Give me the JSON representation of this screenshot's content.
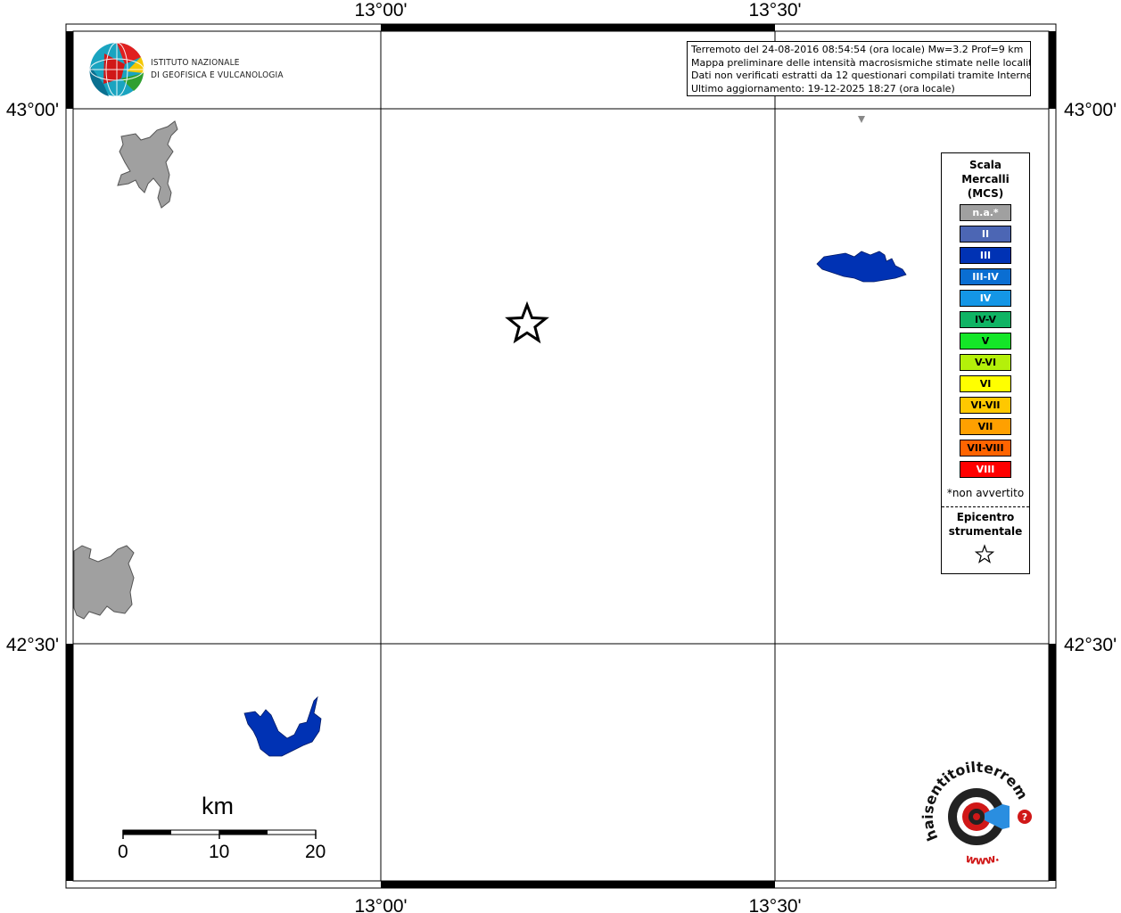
{
  "map": {
    "lon_labels": [
      "13°00'",
      "13°30'"
    ],
    "lat_labels": [
      "43°00'",
      "42°30'"
    ]
  },
  "info": {
    "line1": "Terremoto del 24-08-2016 08:54:54 (ora locale) Mw=3.2 Prof=9 km",
    "line2": "Mappa preliminare delle intensità macrosismiche stimate nelle località",
    "line3": "Dati non verificati estratti da 12 questionari compilati tramite Internet.",
    "line4": "Ultimo aggiornamento: 19-12-2025 18:27 (ora locale)"
  },
  "logo": {
    "line1": "ISTITUTO NAZIONALE",
    "line2": "DI GEOFISICA E VULCANOLOGIA"
  },
  "legend": {
    "title_line1": "Scala",
    "title_line2": "Mercalli",
    "title_line3": "(MCS)",
    "items": [
      {
        "label": "n.a.*",
        "color": "#a0a0a0"
      },
      {
        "label": "II",
        "color": "#4c66b4"
      },
      {
        "label": "III",
        "color": "#0032b4"
      },
      {
        "label": "III-IV",
        "color": "#0a6ed2"
      },
      {
        "label": "IV",
        "color": "#1496e6"
      },
      {
        "label": "IV-V",
        "color": "#0fb464"
      },
      {
        "label": "V",
        "color": "#14e628"
      },
      {
        "label": "V-VI",
        "color": "#b4f00a"
      },
      {
        "label": "VI",
        "color": "#ffff00"
      },
      {
        "label": "VI-VII",
        "color": "#ffc800"
      },
      {
        "label": "VII",
        "color": "#ffa000"
      },
      {
        "label": "VII-VIII",
        "color": "#ff6400"
      },
      {
        "label": "VIII",
        "color": "#ff0000"
      }
    ],
    "note": "*non avvertito",
    "epi_line1": "Epicentro",
    "epi_line2": "strumentale"
  },
  "scalebar": {
    "unit": "km",
    "ticks": [
      "0",
      "10",
      "20"
    ]
  },
  "hsit_logo": {
    "text": "haisentitoilterremoto.it",
    "url": "www."
  }
}
